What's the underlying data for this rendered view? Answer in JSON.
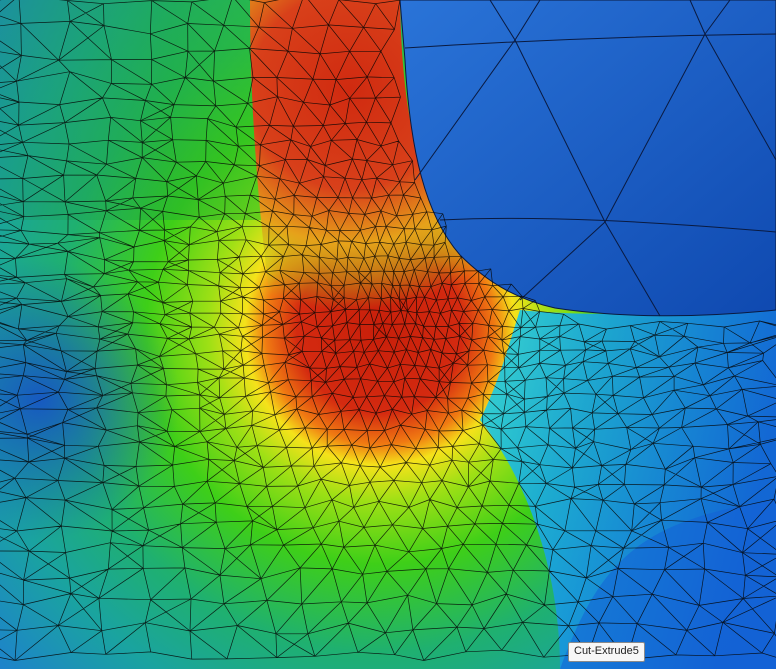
{
  "viewport": {
    "description_colors": {
      "background_blue": "#1b5fc7",
      "max": "#d42a10",
      "high": "#f5e21a",
      "mid": "#3ecf18",
      "low": "#1ec9d8",
      "min": "#1040c0"
    }
  },
  "tooltip": {
    "label": "Cut-Extrude5"
  }
}
